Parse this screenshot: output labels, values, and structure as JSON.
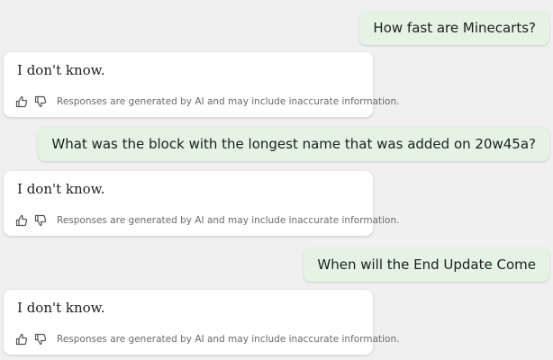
{
  "messages": [
    {
      "role": "user",
      "text": "How fast are Minecarts?"
    },
    {
      "role": "bot",
      "text": "I don't know.",
      "disclaimer": "Responses are generated by AI and may include inaccurate information."
    },
    {
      "role": "user",
      "text": "What was the block with the longest name that was added on 20w45a?"
    },
    {
      "role": "bot",
      "text": "I don't know.",
      "disclaimer": "Responses are generated by AI and may include inaccurate information."
    },
    {
      "role": "user",
      "text": "When will the End Update Come"
    },
    {
      "role": "bot",
      "text": "I don't know.",
      "disclaimer": "Responses are generated by AI and may include inaccurate information."
    }
  ],
  "icons": {
    "like": "thumbs-up-icon",
    "dislike": "thumbs-down-icon"
  },
  "colors": {
    "background": "#f0f0f0",
    "user_bubble": "#e4f3e4",
    "bot_card": "#ffffff",
    "text": "#1e1e1e",
    "muted_text": "#6a6a6a"
  }
}
